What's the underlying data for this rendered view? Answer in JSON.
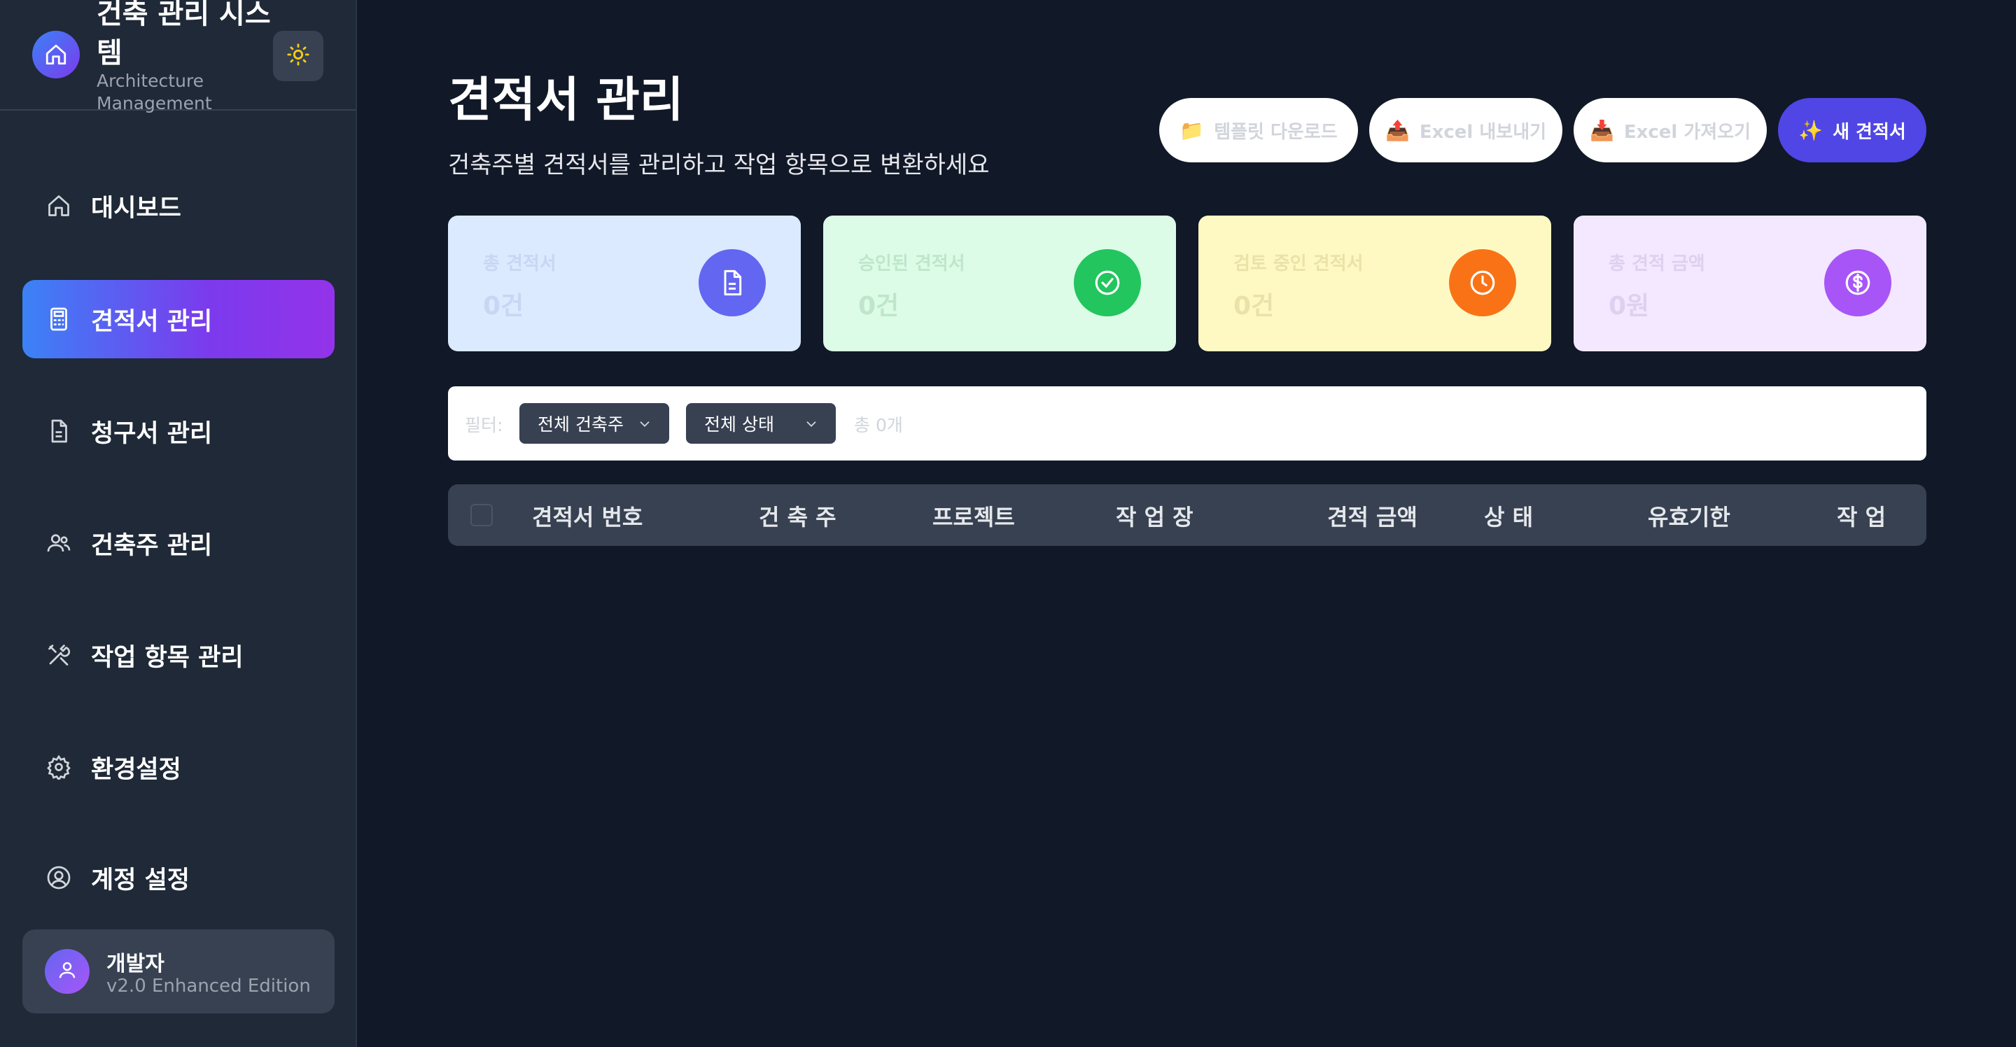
{
  "sidebar": {
    "brand_title": "건축 관리 시스템",
    "brand_subtitle": "Architecture Management",
    "items": [
      {
        "label": "대시보드",
        "icon": "home-icon"
      },
      {
        "label": "견적서 관리",
        "icon": "calculator-icon",
        "active": true
      },
      {
        "label": "청구서 관리",
        "icon": "document-icon"
      },
      {
        "label": "건축주 관리",
        "icon": "users-icon"
      },
      {
        "label": "작업 항목 관리",
        "icon": "tools-icon"
      },
      {
        "label": "환경설정",
        "icon": "gear-icon"
      },
      {
        "label": "계정 설정",
        "icon": "user-circle-icon"
      }
    ],
    "user": {
      "name": "개발자",
      "subtitle": "v2.0 Enhanced Edition"
    }
  },
  "header": {
    "title": "견적서 관리",
    "description": "건축주별 견적서를 관리하고 작업 항목으로 변환하세요",
    "buttons": {
      "template": {
        "icon": "📁",
        "label": "템플릿 다운로드"
      },
      "export": {
        "icon": "📤",
        "label": "Excel 내보내기"
      },
      "import": {
        "icon": "📥",
        "label": "Excel 가져오기"
      },
      "new": {
        "icon": "✨",
        "label": "새 견적서"
      }
    }
  },
  "stats": [
    {
      "label": "총 견적서",
      "value": "0건",
      "icon": "document-icon",
      "bg": "#dbeafe",
      "icon_bg": "#6366f1",
      "text": "#c7d7f3"
    },
    {
      "label": "승인된 견적서",
      "value": "0건",
      "icon": "check-circle-icon",
      "bg": "#dcfce7",
      "icon_bg": "#22c55e",
      "text": "#bfe6cb"
    },
    {
      "label": "검토 중인 견적서",
      "value": "0건",
      "icon": "clock-icon",
      "bg": "#fef9c3",
      "icon_bg": "#f97316",
      "text": "#eae2a8"
    },
    {
      "label": "총 견적 금액",
      "value": "0원",
      "icon": "dollar-icon",
      "bg": "#f3e8ff",
      "icon_bg": "#a855f7",
      "text": "#dfd0ef"
    }
  ],
  "filters": {
    "label": "필터:",
    "client": "전체 건축주",
    "status": "전체 상태",
    "count": "총 0개"
  },
  "table": {
    "columns": [
      "견적서 번호",
      "건 축 주",
      "프로젝트",
      "작 업 장",
      "견적 금액",
      "상  태",
      "유효기한",
      "작  업"
    ]
  },
  "colors": {
    "background": "#111827",
    "sidebar": "#1f2937",
    "accent": "#4f46e5"
  }
}
